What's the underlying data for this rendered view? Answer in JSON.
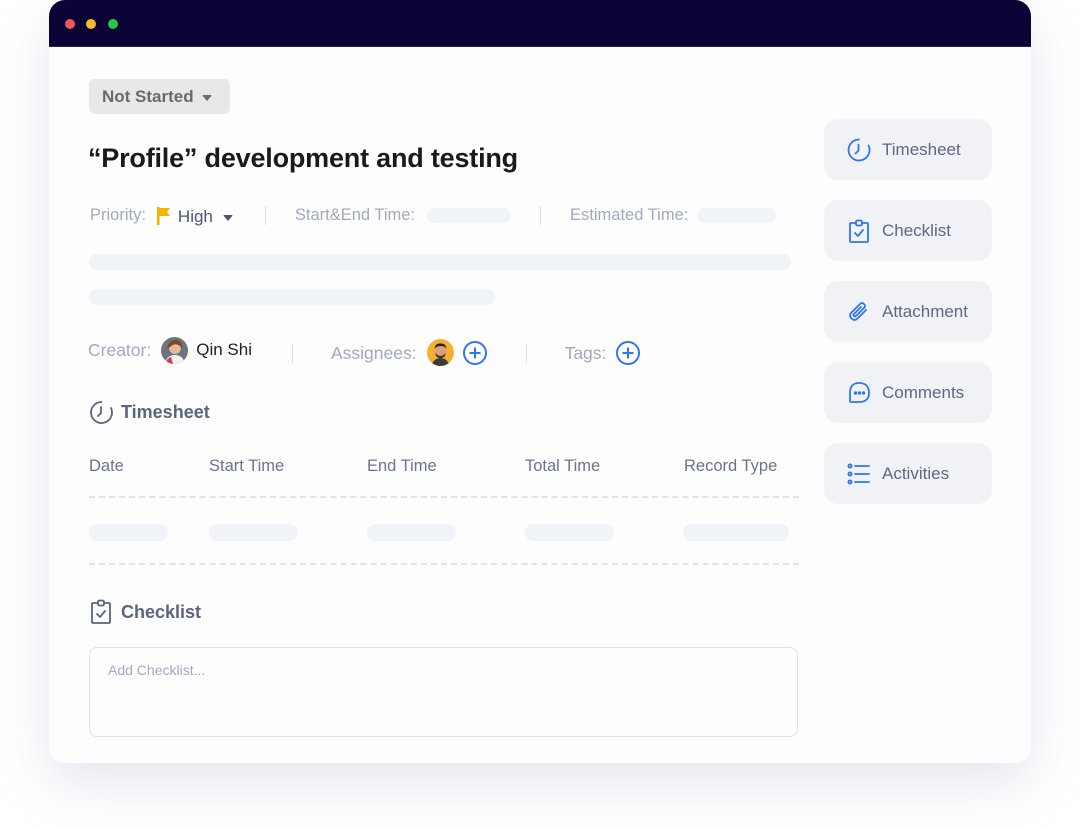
{
  "window": {
    "controls": [
      {
        "name": "close",
        "color": "#f0555a"
      },
      {
        "name": "minimize",
        "color": "#f5bb2e"
      },
      {
        "name": "maximize",
        "color": "#27c840"
      }
    ]
  },
  "task": {
    "status": "Not Started",
    "title": "“Profile” development and testing",
    "priority_label": "Priority:",
    "priority_value": "High",
    "priority_color": "#f5b400",
    "start_end_label": "Start&End Time:",
    "estimated_label": "Estimated Time:",
    "creator_label": "Creator:",
    "creator_name": "Qin Shi",
    "assignees_label": "Assignees:",
    "tags_label": "Tags:"
  },
  "timesheet": {
    "heading": "Timesheet",
    "columns": [
      "Date",
      "Start Time",
      "End Time",
      "Total Time",
      "Record Type"
    ]
  },
  "checklist": {
    "heading": "Checklist",
    "placeholder": "Add Checklist...",
    "value": ""
  },
  "sidebar": {
    "accent": "#2f76ea",
    "items": [
      {
        "label": "Timesheet",
        "icon": "clock-icon"
      },
      {
        "label": "Checklist",
        "icon": "clipboard-check-icon"
      },
      {
        "label": "Attachment",
        "icon": "paperclip-icon"
      },
      {
        "label": "Comments",
        "icon": "chat-bubble-icon"
      },
      {
        "label": "Activities",
        "icon": "list-icon"
      }
    ]
  }
}
